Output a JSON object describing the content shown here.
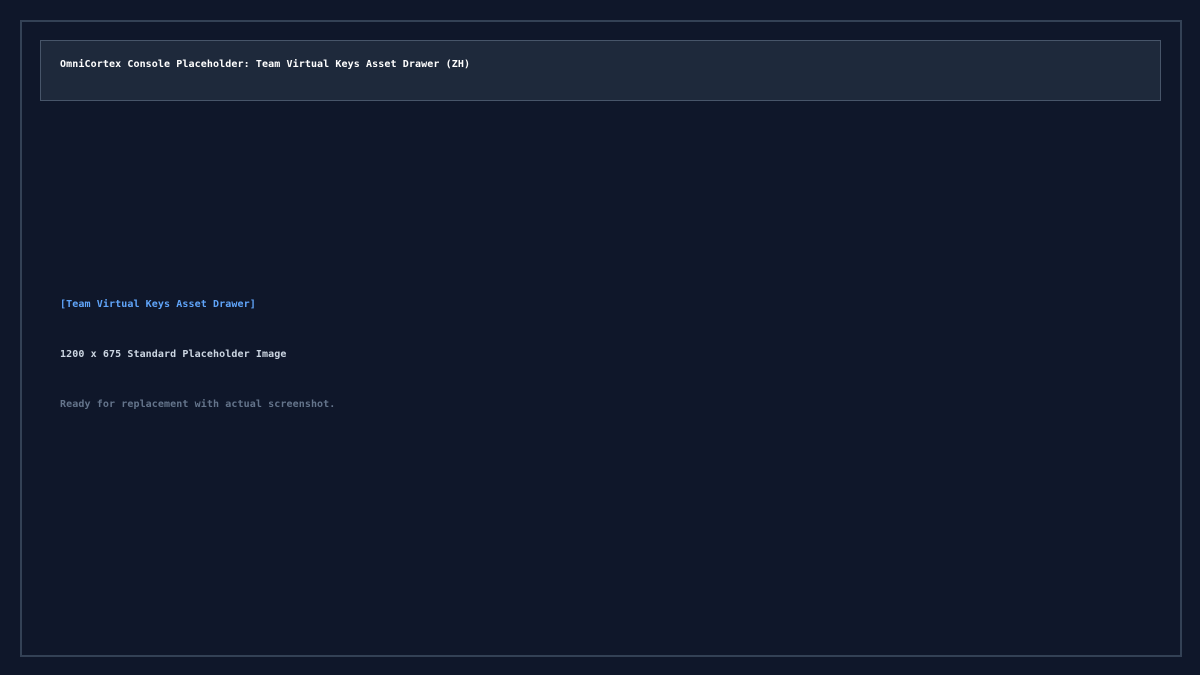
{
  "header": {
    "title": "OmniCortex Console Placeholder: Team Virtual Keys Asset Drawer (ZH)"
  },
  "content": {
    "tag": "[Team Virtual Keys Asset Drawer]",
    "dimensions": "1200 x 675 Standard Placeholder Image",
    "status": "Ready for replacement with actual screenshot."
  },
  "colors": {
    "background": "#0f172a",
    "panel": "#1e293b",
    "border": "#334155",
    "accent": "#60a5fa",
    "text_primary": "#ffffff",
    "text_secondary": "#cbd5e1",
    "text_muted": "#64748b"
  }
}
